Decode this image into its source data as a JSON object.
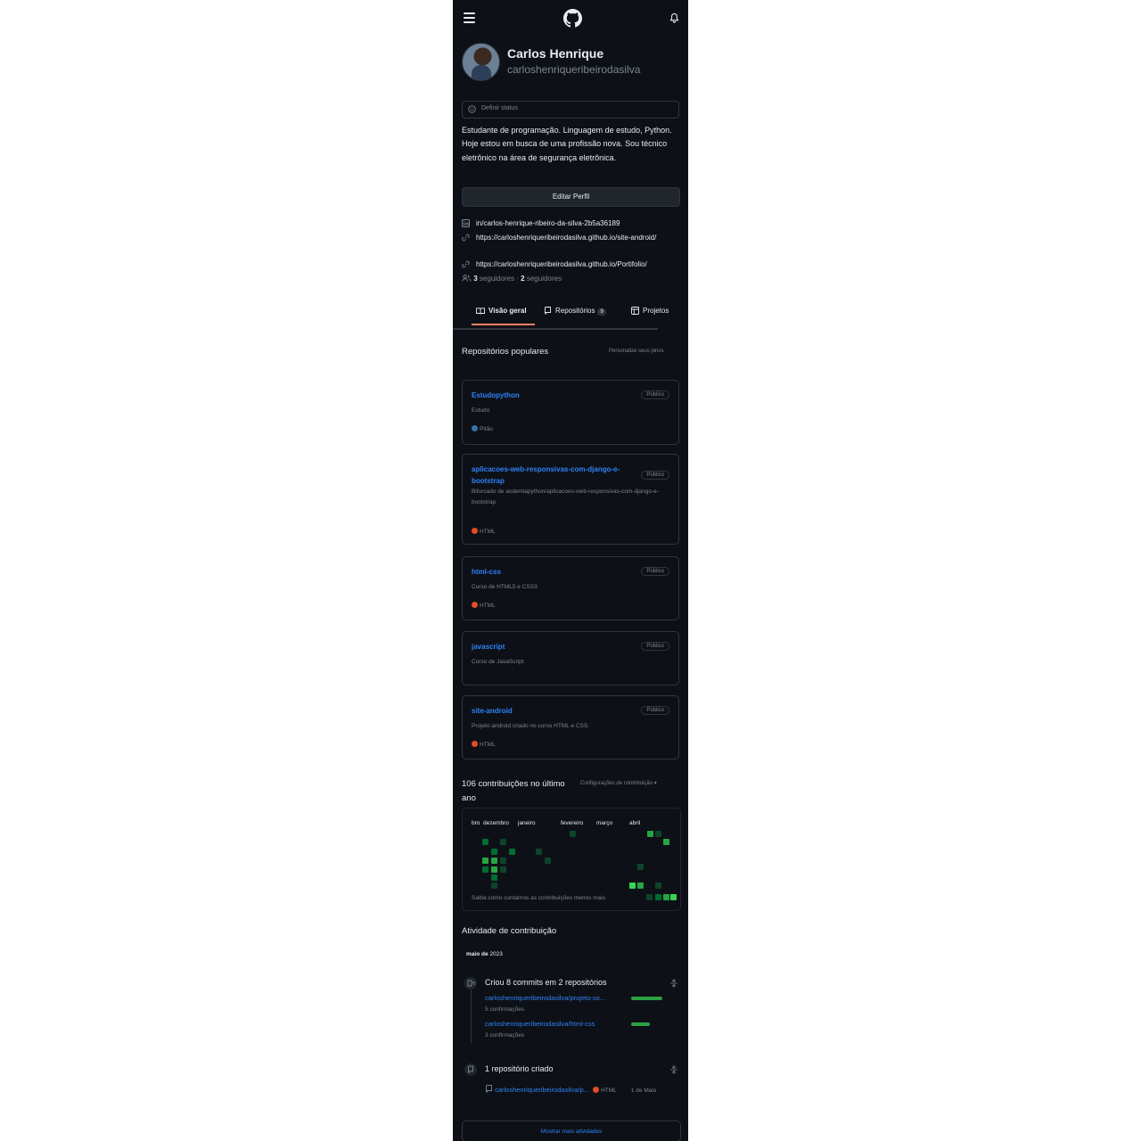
{
  "profile": {
    "name": "Carlos Henrique",
    "username": "carloshenriqueribeirodasilva",
    "status_placeholder": "Definir status",
    "bio": "Estudante de programação. Linguagem de estudo, Python. Hoje estou em busca de uma profissão nova. Sou técnico eletrônico na área de segurança eletrônica.",
    "edit_button": "Editar Perfil",
    "links": [
      {
        "icon": "linkedin-icon",
        "text": "in/carlos-henrique-ribeiro-da-silva-2b5a36189"
      },
      {
        "icon": "link-icon",
        "text": "https://carloshenriqueribeirodasilva.github.io/site-android/"
      },
      {
        "icon": "link-icon",
        "text": "https://carloshenriqueribeirodasilva.github.io/Portifolio/"
      }
    ],
    "followers_count": "3",
    "followers_label": "seguidores",
    "following_count": "2",
    "following_label": "seguidores"
  },
  "tabs": [
    {
      "label": "Visão geral",
      "icon": "book-icon",
      "active": true
    },
    {
      "label": "Repositórios",
      "icon": "repo-icon",
      "count": "9"
    },
    {
      "label": "Projetos",
      "icon": "table-icon"
    }
  ],
  "popular": {
    "title": "Repositórios populares",
    "customize": "Personalize seus pinos",
    "repos": [
      {
        "name": "Estudopython",
        "visibility": "Público",
        "description": "Estudo",
        "language": "Pitão",
        "lang_color": "#3572A5"
      },
      {
        "name": "aplicacoes-web-responsivas-com-django-e-bootstrap",
        "visibility": "Público",
        "description": "Bifurcado de acdemiapython/aplicacoes-web-responsivas-com-django-e-bootstrap",
        "language": "HTML",
        "lang_color": "#e34c26"
      },
      {
        "name": "html-css",
        "visibility": "Público",
        "description": "Curso de HTML5 e CSS3",
        "language": "HTML",
        "lang_color": "#e34c26"
      },
      {
        "name": "javascript",
        "visibility": "Público",
        "description": "Curso de JavaScript",
        "language": "",
        "lang_color": ""
      },
      {
        "name": "site-android",
        "visibility": "Público",
        "description": "Projeto android criado no curso HTML e CSS.",
        "language": "HTML",
        "lang_color": "#e34c26"
      }
    ]
  },
  "contributions": {
    "title": "106 contribuições no último ano",
    "settings": "Configurações de contribuição ▾",
    "months": [
      "bro",
      "dezembro",
      "janeiro",
      "fevereiro",
      "março",
      "abril"
    ],
    "footer_learn": "Saiba como contamos as contribuições",
    "legend_less": "menos",
    "legend_more": "mais",
    "level_colors": [
      "#0e4429",
      "#006d32",
      "#26a641",
      "#39d353"
    ]
  },
  "activity": {
    "title": "Atividade de contribuição",
    "month_bold": "maio de",
    "month_year": "2023",
    "commits_title": "Criou 8 commits em 2 repositórios",
    "commit_items": [
      {
        "repo": "carloshenriqueribeirodasilva/projeto-so...",
        "count": "5 confirmações",
        "share": 1.0
      },
      {
        "repo": "carloshenriqueribeirodasilva/html-css",
        "count": "3 confirmações",
        "share": 0.6
      }
    ],
    "created_title": "1 repositório criado",
    "created_repo": "carloshenriqueribeirodasilva/p...",
    "created_lang": "HTML",
    "created_date": "1 de Maio",
    "show_more": "Mostrar mais atividades"
  }
}
